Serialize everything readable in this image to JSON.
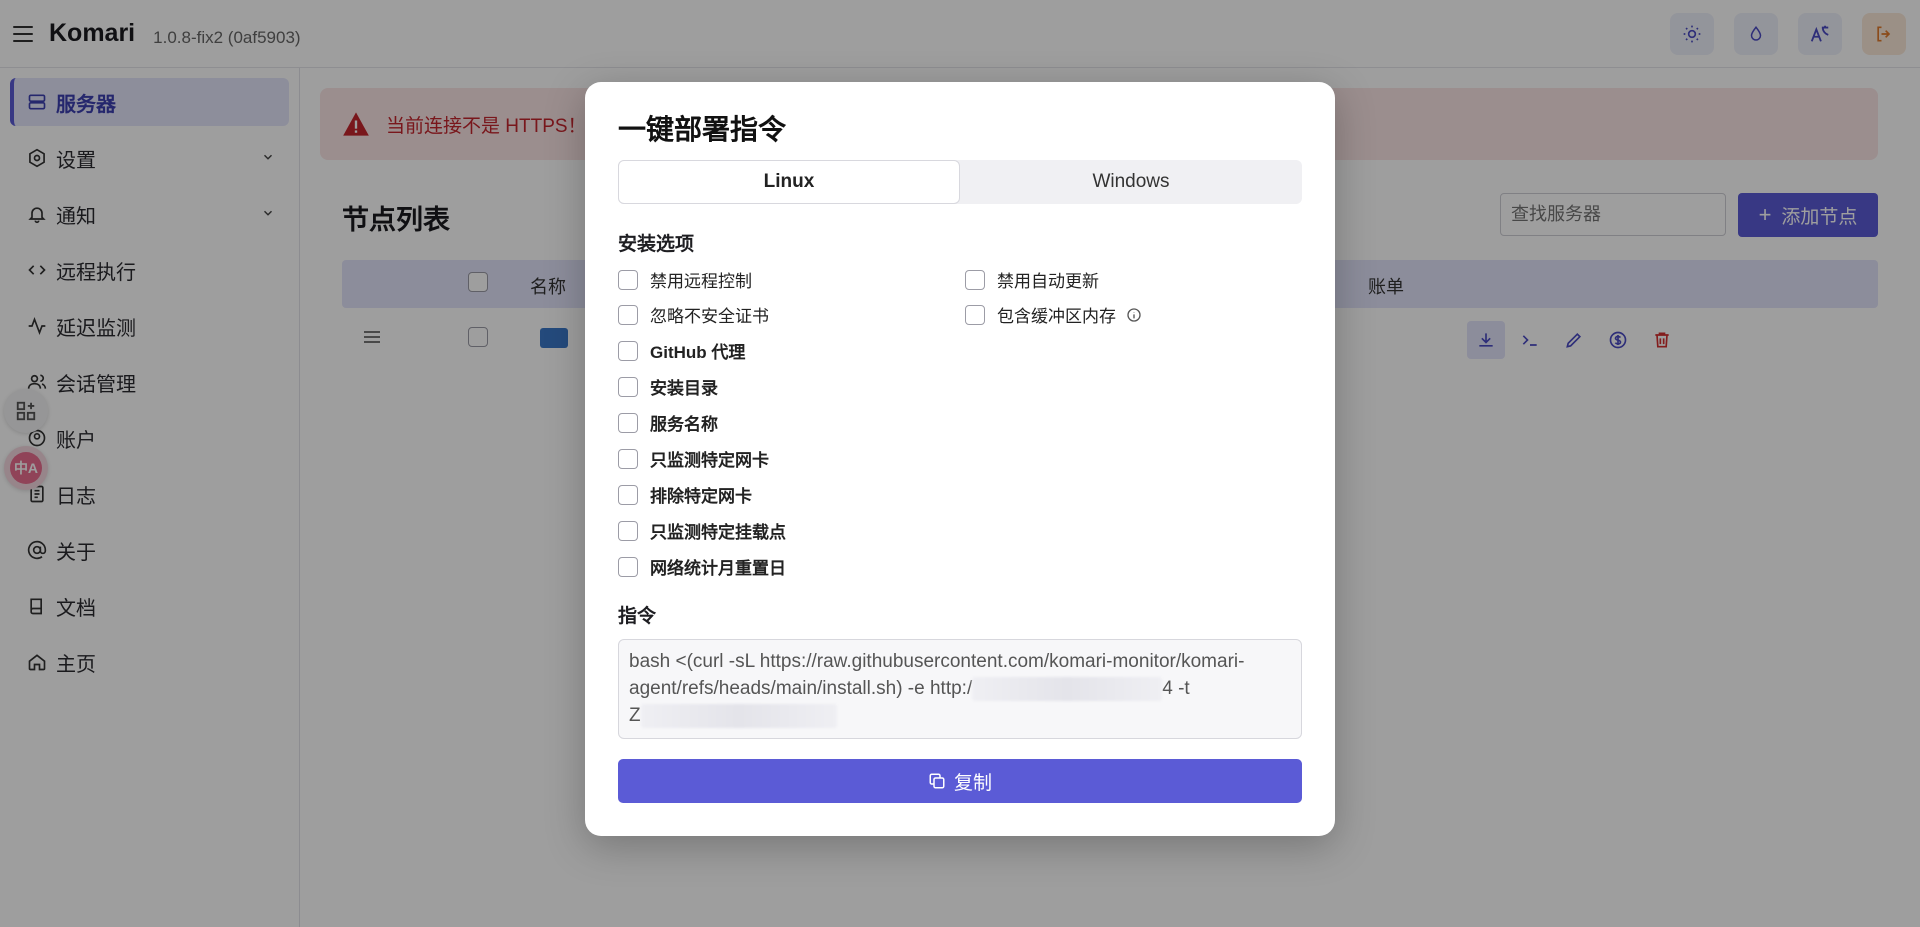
{
  "header": {
    "app_title": "Komari",
    "version": "1.0.8-fix2 (0af5903)"
  },
  "sidebar": {
    "items": [
      {
        "label": "服务器",
        "icon": "server-icon",
        "active": true
      },
      {
        "label": "设置",
        "icon": "settings-icon",
        "expandable": true
      },
      {
        "label": "通知",
        "icon": "bell-icon",
        "expandable": true
      },
      {
        "label": "远程执行",
        "icon": "code-icon"
      },
      {
        "label": "延迟监测",
        "icon": "activity-icon"
      },
      {
        "label": "会话管理",
        "icon": "users-icon"
      },
      {
        "label": "账户",
        "icon": "user-circle-icon"
      },
      {
        "label": "日志",
        "icon": "file-text-icon"
      },
      {
        "label": "关于",
        "icon": "at-sign-icon"
      },
      {
        "label": "文档",
        "icon": "book-icon"
      },
      {
        "label": "主页",
        "icon": "home-icon"
      }
    ],
    "translate_bubble": "中A"
  },
  "main": {
    "alert_text": "当前连接不是 HTTPS！",
    "page_title": "节点列表",
    "search_placeholder": "查找服务器",
    "add_button": "添加节点",
    "table": {
      "columns": [
        "名称",
        "账单"
      ]
    }
  },
  "modal": {
    "title": "一键部署指令",
    "tabs": [
      "Linux",
      "Windows"
    ],
    "install_options_label": "安装选项",
    "options_left": [
      {
        "label": "禁用远程控制",
        "bold": false
      },
      {
        "label": "忽略不安全证书",
        "bold": false
      },
      {
        "label": "GitHub 代理",
        "bold": true
      },
      {
        "label": "安装目录",
        "bold": true
      },
      {
        "label": "服务名称",
        "bold": true
      },
      {
        "label": "只监测特定网卡",
        "bold": true
      },
      {
        "label": "排除特定网卡",
        "bold": true
      },
      {
        "label": "只监测特定挂载点",
        "bold": true
      },
      {
        "label": "网络统计月重置日",
        "bold": true
      }
    ],
    "options_right": [
      {
        "label": "禁用自动更新"
      },
      {
        "label": "包含缓冲区内存"
      }
    ],
    "command_label": "指令",
    "command_line1": "bash <(curl -sL https://raw.githubusercontent.com/komari-monitor/komari-",
    "command_line2_start": "agent/refs/heads/main/install.sh) -e http:/",
    "command_line2_end": "4 -t",
    "command_line3_start": "Z",
    "copy_button": "复制"
  },
  "colors": {
    "accent": "#5b5bd6",
    "alert_bg": "#fbe5e5",
    "alert_text": "#c4262e",
    "delete": "#d32f2f"
  }
}
